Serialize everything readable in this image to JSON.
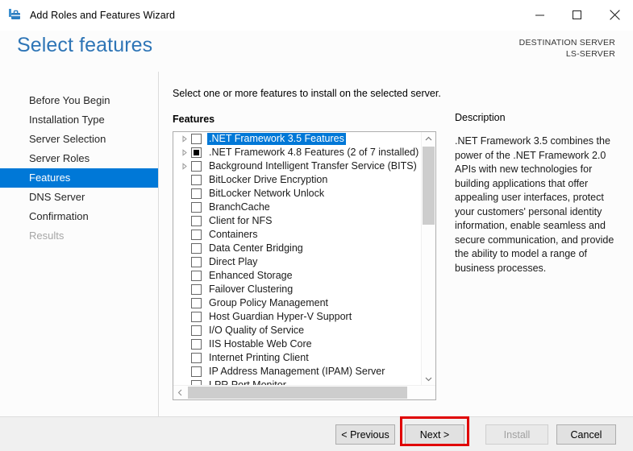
{
  "window": {
    "title": "Add Roles and Features Wizard",
    "icon": "toolbox-icon",
    "controls": {
      "minimize": "minimize-icon",
      "maximize": "maximize-icon",
      "close": "close-icon"
    }
  },
  "header": {
    "page_title": "Select features",
    "destination_label": "DESTINATION SERVER",
    "destination_server": "LS-SERVER",
    "accent_color": "#2e75b6"
  },
  "sidebar": {
    "items": [
      {
        "label": "Before You Begin",
        "state": "normal"
      },
      {
        "label": "Installation Type",
        "state": "normal"
      },
      {
        "label": "Server Selection",
        "state": "normal"
      },
      {
        "label": "Server Roles",
        "state": "normal"
      },
      {
        "label": "Features",
        "state": "active"
      },
      {
        "label": "DNS Server",
        "state": "normal"
      },
      {
        "label": "Confirmation",
        "state": "normal"
      },
      {
        "label": "Results",
        "state": "disabled"
      }
    ],
    "active_color": "#0078d7"
  },
  "main": {
    "instruction": "Select one or more features to install on the selected server.",
    "features_label": "Features",
    "features": [
      {
        "label": ".NET Framework 3.5 Features",
        "expandable": true,
        "checkbox": "unchecked",
        "selected": true
      },
      {
        "label": ".NET Framework 4.8 Features (2 of 7 installed)",
        "expandable": true,
        "checkbox": "partial",
        "selected": false
      },
      {
        "label": "Background Intelligent Transfer Service (BITS)",
        "expandable": true,
        "checkbox": "unchecked",
        "selected": false
      },
      {
        "label": "BitLocker Drive Encryption",
        "expandable": false,
        "checkbox": "unchecked",
        "selected": false
      },
      {
        "label": "BitLocker Network Unlock",
        "expandable": false,
        "checkbox": "unchecked",
        "selected": false
      },
      {
        "label": "BranchCache",
        "expandable": false,
        "checkbox": "unchecked",
        "selected": false
      },
      {
        "label": "Client for NFS",
        "expandable": false,
        "checkbox": "unchecked",
        "selected": false
      },
      {
        "label": "Containers",
        "expandable": false,
        "checkbox": "unchecked",
        "selected": false
      },
      {
        "label": "Data Center Bridging",
        "expandable": false,
        "checkbox": "unchecked",
        "selected": false
      },
      {
        "label": "Direct Play",
        "expandable": false,
        "checkbox": "unchecked",
        "selected": false
      },
      {
        "label": "Enhanced Storage",
        "expandable": false,
        "checkbox": "unchecked",
        "selected": false
      },
      {
        "label": "Failover Clustering",
        "expandable": false,
        "checkbox": "unchecked",
        "selected": false
      },
      {
        "label": "Group Policy Management",
        "expandable": false,
        "checkbox": "unchecked",
        "selected": false
      },
      {
        "label": "Host Guardian Hyper-V Support",
        "expandable": false,
        "checkbox": "unchecked",
        "selected": false
      },
      {
        "label": "I/O Quality of Service",
        "expandable": false,
        "checkbox": "unchecked",
        "selected": false
      },
      {
        "label": "IIS Hostable Web Core",
        "expandable": false,
        "checkbox": "unchecked",
        "selected": false
      },
      {
        "label": "Internet Printing Client",
        "expandable": false,
        "checkbox": "unchecked",
        "selected": false
      },
      {
        "label": "IP Address Management (IPAM) Server",
        "expandable": false,
        "checkbox": "unchecked",
        "selected": false
      },
      {
        "label": "LPR Port Monitor",
        "expandable": false,
        "checkbox": "unchecked",
        "selected": false
      }
    ],
    "description": {
      "title": "Description",
      "text": ".NET Framework 3.5 combines the power of the .NET Framework 2.0 APIs with new technologies for building applications that offer appealing user interfaces, protect your customers' personal identity information, enable seamless and secure communication, and provide the ability to model a range of business processes."
    }
  },
  "footer": {
    "previous_label": "< Previous",
    "next_label": "Next >",
    "install_label": "Install",
    "cancel_label": "Cancel",
    "highlight_color": "#e00000"
  }
}
